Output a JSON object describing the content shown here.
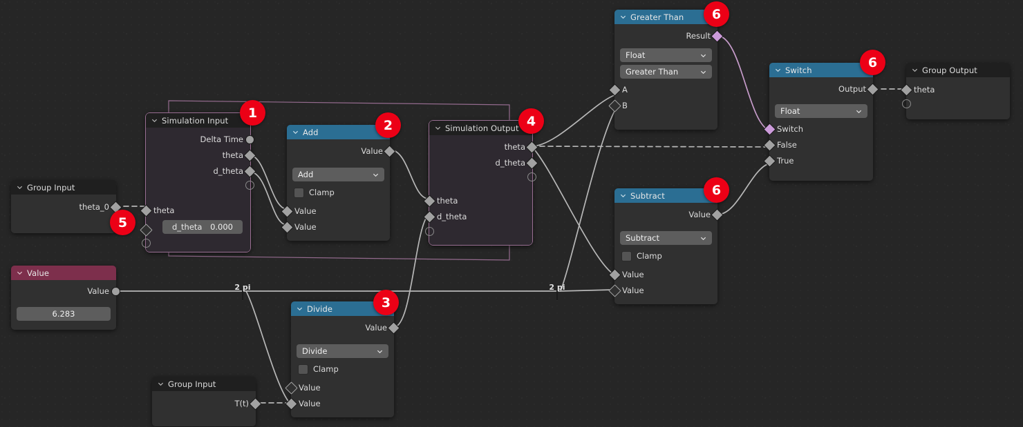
{
  "app": {
    "editor": "Blender Geometry Node Editor",
    "background_color": "#262626"
  },
  "colors": {
    "header_blue": "#2b6e93",
    "header_dark": "#1f1f1f",
    "header_maroon": "#7d2f4c",
    "node_body": "#303030",
    "sim_zone_border": "#9a6f93",
    "badge_red": "#ec0016",
    "wire_gray": "#b8b8b8",
    "wire_purple": "#c79ccb",
    "socket_gray": "#a1a1a1",
    "socket_boolean": "#cc9bda"
  },
  "nodes": {
    "simulation_input": {
      "title": "Simulation Input",
      "outputs": [
        "Delta Time",
        "theta",
        "d_theta"
      ],
      "inputs": [
        "theta"
      ],
      "field": {
        "label": "d_theta",
        "value": "0.000"
      }
    },
    "add": {
      "title": "Add",
      "outputs": [
        "Value"
      ],
      "operation": "Add",
      "clamp_label": "Clamp",
      "clamp_checked": false,
      "inputs": [
        "Value",
        "Value"
      ]
    },
    "simulation_output": {
      "title": "Simulation Output",
      "outputs": [
        "theta",
        "d_theta"
      ],
      "inputs": [
        "theta",
        "d_theta"
      ]
    },
    "greater_than": {
      "title": "Greater Than",
      "outputs": [
        "Result"
      ],
      "data_type": "Float",
      "operation": "Greater Than",
      "inputs": [
        "A",
        "B"
      ]
    },
    "switch": {
      "title": "Switch",
      "outputs": [
        "Output"
      ],
      "data_type": "Float",
      "inputs": [
        "Switch",
        "False",
        "True"
      ]
    },
    "group_output": {
      "title": "Group Output",
      "inputs": [
        "theta"
      ]
    },
    "subtract": {
      "title": "Subtract",
      "outputs": [
        "Value"
      ],
      "operation": "Subtract",
      "clamp_label": "Clamp",
      "clamp_checked": false,
      "inputs": [
        "Value",
        "Value"
      ]
    },
    "divide": {
      "title": "Divide",
      "outputs": [
        "Value"
      ],
      "operation": "Divide",
      "clamp_label": "Clamp",
      "clamp_checked": false,
      "inputs": [
        "Value",
        "Value"
      ]
    },
    "value": {
      "title": "Value",
      "outputs": [
        "Value"
      ],
      "value": "6.283"
    },
    "group_input_top": {
      "title": "Group Input",
      "outputs": [
        "theta_0"
      ]
    },
    "group_input_bottom": {
      "title": "Group Input",
      "outputs": [
        "T(t)"
      ]
    }
  },
  "reroutes": [
    {
      "label": "2 pi"
    },
    {
      "label": "2 pi"
    }
  ],
  "badges": [
    {
      "number": "1"
    },
    {
      "number": "2"
    },
    {
      "number": "3"
    },
    {
      "number": "4"
    },
    {
      "number": "5"
    },
    {
      "number": "6"
    },
    {
      "number": "6"
    },
    {
      "number": "6"
    }
  ]
}
